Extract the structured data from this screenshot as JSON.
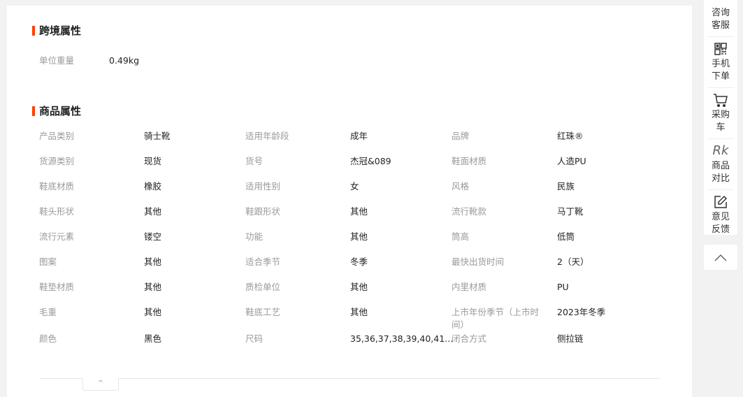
{
  "cross_border": {
    "title": "跨境属性",
    "weight_label": "单位重量",
    "weight_value": "0.49kg"
  },
  "product": {
    "title": "商品属性",
    "rows": [
      [
        [
          "产品类别",
          "骑士靴"
        ],
        [
          "适用年龄段",
          "成年"
        ],
        [
          "品牌",
          "红珠®"
        ]
      ],
      [
        [
          "货源类别",
          "现货"
        ],
        [
          "货号",
          "杰冠&089"
        ],
        [
          "鞋面材质",
          "人造PU"
        ]
      ],
      [
        [
          "鞋底材质",
          "橡胶"
        ],
        [
          "适用性别",
          "女"
        ],
        [
          "风格",
          "民族"
        ]
      ],
      [
        [
          "鞋头形状",
          "其他"
        ],
        [
          "鞋跟形状",
          "其他"
        ],
        [
          "流行靴款",
          "马丁靴"
        ]
      ],
      [
        [
          "流行元素",
          "镂空"
        ],
        [
          "功能",
          "其他"
        ],
        [
          "筒高",
          "低筒"
        ]
      ],
      [
        [
          "图案",
          "其他"
        ],
        [
          "适合季节",
          "冬季"
        ],
        [
          "最快出货时间",
          "2（天）"
        ]
      ],
      [
        [
          "鞋垫材质",
          "其他"
        ],
        [
          "质检单位",
          "其他"
        ],
        [
          "内里材质",
          "PU"
        ]
      ],
      [
        [
          "毛重",
          "其他"
        ],
        [
          "鞋底工艺",
          "其他"
        ],
        [
          "上市年份季节（上市时间）",
          "2023年冬季"
        ]
      ],
      [
        [
          "颜色",
          "黑色"
        ],
        [
          "尺码",
          "35,36,37,38,39,40,41..."
        ],
        [
          "闭合方式",
          "侧拉链"
        ]
      ]
    ]
  },
  "sidebar": {
    "items": [
      {
        "label1": "咨询",
        "label2": "客服",
        "icon": "headset-icon"
      },
      {
        "label1": "手机",
        "label2": "下单",
        "icon": "qr-code-icon"
      },
      {
        "label1": "采购车",
        "label2": "",
        "icon": "cart-icon"
      },
      {
        "label1": "商品",
        "label2": "对比",
        "icon": "compare-icon"
      },
      {
        "label1": "意见",
        "label2": "反馈",
        "icon": "feedback-icon"
      }
    ],
    "collapse_symbol": "^"
  }
}
